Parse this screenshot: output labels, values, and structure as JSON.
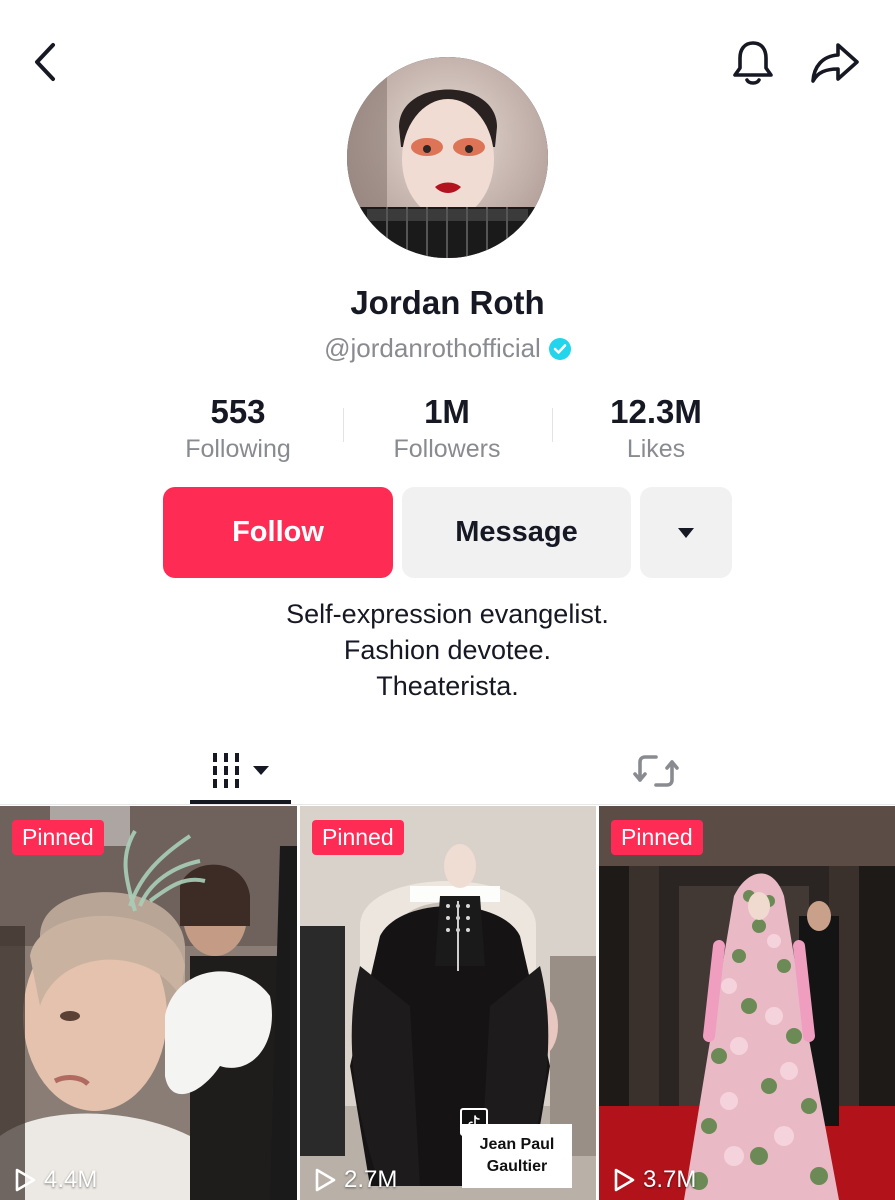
{
  "header": {
    "back_icon": "chevron-left-icon",
    "bell_icon": "bell-icon",
    "share_icon": "share-arrow-icon"
  },
  "profile": {
    "display_name": "Jordan Roth",
    "username": "@jordanrothofficial",
    "verified_icon": "verified-badge-icon",
    "verified_color": "#20d5ec"
  },
  "stats": {
    "following": {
      "value": "553",
      "label": "Following"
    },
    "followers": {
      "value": "1M",
      "label": "Followers"
    },
    "likes": {
      "value": "12.3M",
      "label": "Likes"
    }
  },
  "actions": {
    "follow_label": "Follow",
    "message_label": "Message",
    "more_icon": "caret-down-icon",
    "accent_color": "#fe2c55"
  },
  "bio": {
    "lines": [
      "Self-expression evangelist.",
      "Fashion devotee.",
      "Theaterista."
    ]
  },
  "tabs": {
    "videos_icon": "grid-videos-icon",
    "reposts_icon": "repost-icon",
    "active": "videos"
  },
  "videos": [
    {
      "badge": "Pinned",
      "views": "4.4M"
    },
    {
      "badge": "Pinned",
      "views": "2.7M",
      "overlay_text_1": "Jean Paul",
      "overlay_text_2": "Gaultier"
    },
    {
      "badge": "Pinned",
      "views": "3.7M"
    }
  ]
}
